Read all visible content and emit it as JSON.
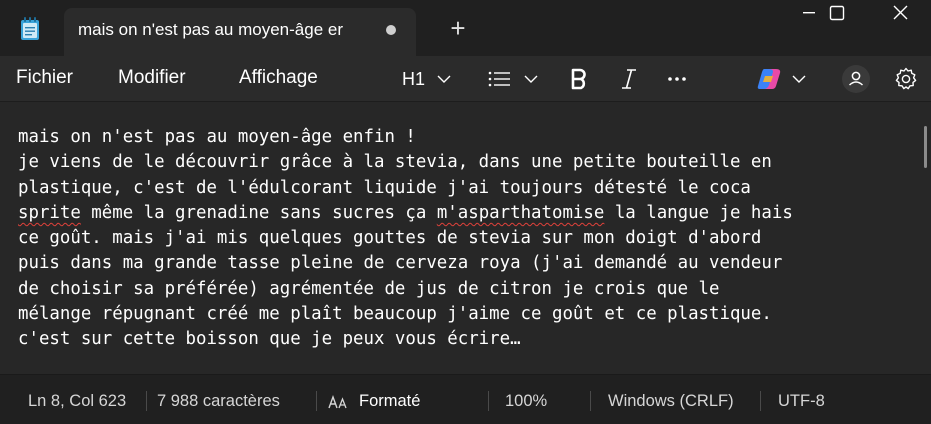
{
  "window": {
    "tab_title": "mais on n'est pas au moyen-âge er",
    "new_tab_label": "+"
  },
  "menu": {
    "items": [
      "Fichier",
      "Modifier",
      "Affichage"
    ]
  },
  "toolbar": {
    "heading_label": "H1",
    "icons": [
      "chevron-down-icon",
      "list-icon",
      "bold-icon",
      "italic-icon",
      "more-icon",
      "copilot-icon",
      "account-icon",
      "gear-icon"
    ]
  },
  "document": {
    "lines": [
      "mais on n'est pas au moyen-âge enfin !",
      "je viens de le découvrir grâce à la stevia, dans une petite bouteille en",
      "plastique, c'est de l'édulcorant liquide j'ai toujours détesté le coca",
      "ce goût. mais j'ai mis quelques gouttes de stevia sur mon doigt d'abord",
      "puis dans ma grande tasse pleine de cerveza roya (j'ai demandé au vendeur",
      "de choisir sa préférée) agrémentée de jus de citron je crois que le",
      "mélange répugnant créé me plaît beaucoup j'aime ce goût et ce plastique.",
      "c'est sur cette boisson que je peux vous écrire…"
    ],
    "line4_parts": [
      "sprite",
      " même la grenadine sans sucres ça ",
      "m'asparthatomise",
      " la langue je hais"
    ]
  },
  "status": {
    "position": "Ln 8, Col 623",
    "chars": "7 988 caractères",
    "format_label": "Formaté",
    "zoom": "100%",
    "line_ending": "Windows (CRLF)",
    "encoding": "UTF-8"
  },
  "colors": {
    "background": "#202020",
    "editor": "#272727",
    "spellcheck": "#e0413a"
  }
}
